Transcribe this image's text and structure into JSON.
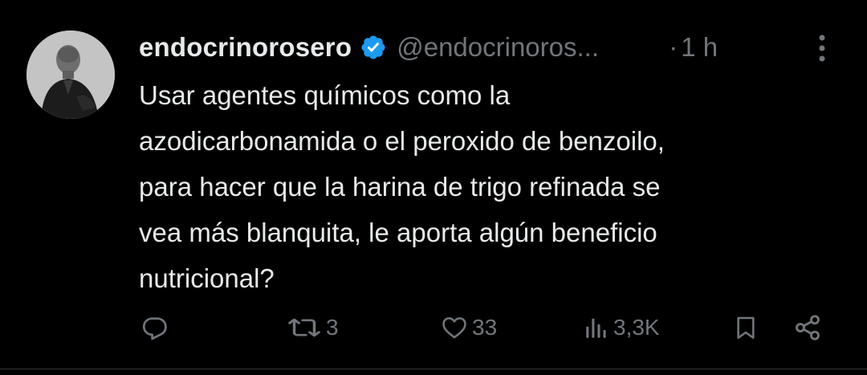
{
  "tweet": {
    "author": {
      "display_name": "endocrinorosero",
      "handle": "@endocrinoros...",
      "verified": true
    },
    "separator": "·",
    "time": "1 h",
    "text_lines": [
      "Usar agentes químicos como la",
      "azodicarbonamida o el peroxido de benzoilo,",
      "para hacer que la harina de trigo refinada se",
      "vea más blanquita, le aporta algún beneficio",
      "nutricional?"
    ],
    "actions": {
      "reply_count": "",
      "retweet_count": "3",
      "like_count": "33",
      "views_count": "3,3K"
    }
  },
  "icons": {
    "verified": "verified-badge-icon",
    "more": "more-vertical-icon",
    "reply": "reply-icon",
    "retweet": "retweet-icon",
    "like": "heart-icon",
    "views": "views-icon",
    "bookmark": "bookmark-icon",
    "share": "share-icon"
  },
  "colors": {
    "background": "#000000",
    "text": "#e7e9ea",
    "secondary": "#71767b",
    "verified": "#1d9bf0"
  }
}
